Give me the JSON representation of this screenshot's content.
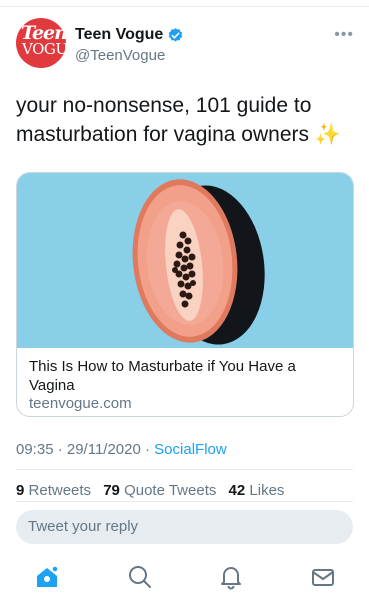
{
  "tweet": {
    "author": {
      "display_name": "Teen Vogue",
      "handle": "@TeenVogue",
      "avatar_text_line1": "Teen",
      "avatar_text_line2": "VOGUE",
      "verified": true
    },
    "more_label": "•••",
    "text": "your no-nonsense, 101 guide to masturbation for vagina owners",
    "emoji": "✨",
    "card": {
      "title": "This Is How to Masturbate if You Have a Vagina",
      "domain": "teenvogue.com",
      "image_icon": "papaya-image"
    },
    "timestamp": "09:35 · 29/11/2020 · ",
    "source": "SocialFlow",
    "stats": {
      "retweets_count": "9",
      "retweets_label": "Retweets",
      "quote_count": "79",
      "quote_label": "Quote Tweets",
      "likes_count": "42",
      "likes_label": "Likes"
    }
  },
  "reply": {
    "placeholder": "Tweet your reply"
  },
  "tabbar": {
    "items": [
      "home-icon",
      "search-icon",
      "notifications-icon",
      "messages-icon"
    ]
  },
  "colors": {
    "accent": "#1da1f2",
    "avatar_bg": "#e0393e",
    "card_bg": "#89cfe8",
    "muted_text": "#657786"
  }
}
